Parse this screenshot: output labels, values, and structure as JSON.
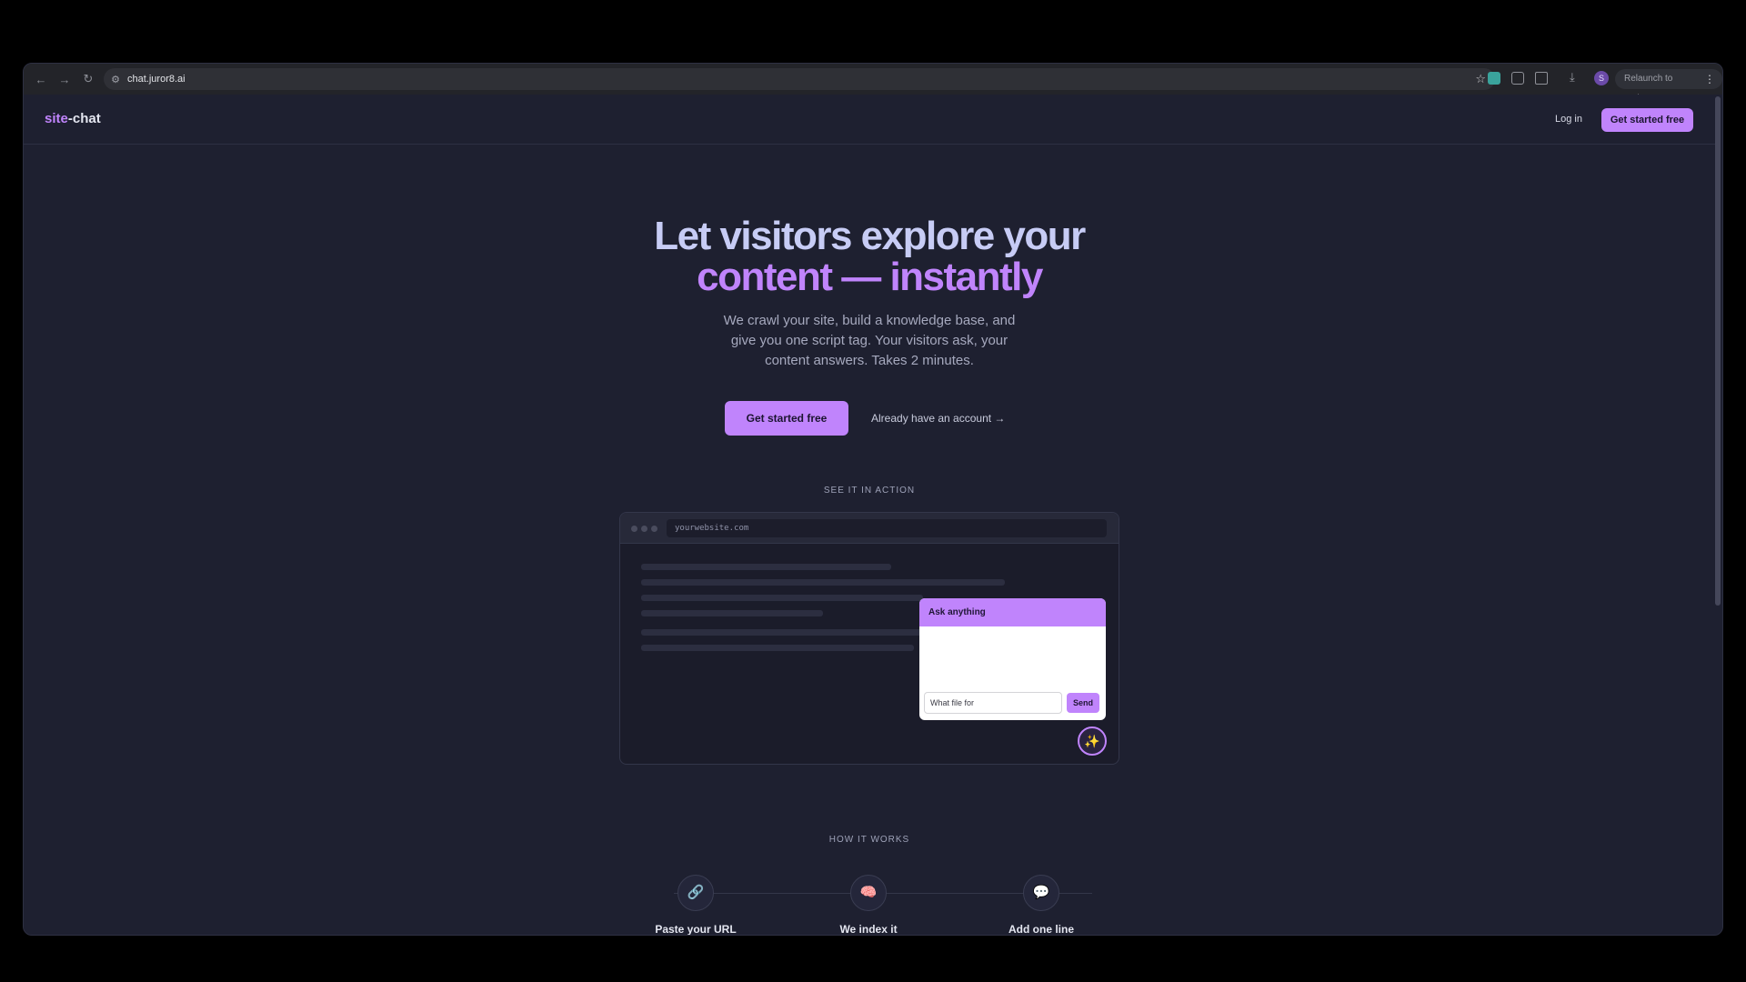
{
  "browser": {
    "url": "chat.juror8.ai",
    "relaunch_label": "Relaunch to update",
    "profile_initial": "S"
  },
  "header": {
    "logo_part1": "site",
    "logo_part2": "-chat",
    "login_label": "Log in",
    "cta_label": "Get started free"
  },
  "hero": {
    "title_line1": "Let visitors explore your",
    "title_line2": "content — instantly",
    "subtitle": "We crawl your site, build a knowledge base, and give you one script tag. Your visitors ask, your content answers. Takes 2 minutes.",
    "primary_cta": "Get started free",
    "secondary_cta": "Already have an account →"
  },
  "demo": {
    "section_label": "SEE IT IN ACTION",
    "url": "yourwebsite.com",
    "chat_title": "Ask anything",
    "chat_input_value": "What file for",
    "send_label": "Send"
  },
  "how_it_works": {
    "section_label": "HOW IT WORKS",
    "steps": [
      {
        "label": "Paste your URL",
        "icon": "link-icon"
      },
      {
        "label": "We index it",
        "icon": "brain-icon"
      },
      {
        "label": "Add one line",
        "icon": "chat-bubble-icon"
      }
    ]
  },
  "colors": {
    "accent": "#c084fc",
    "background": "#1e2030",
    "hero_text": "#c7ccf5"
  }
}
